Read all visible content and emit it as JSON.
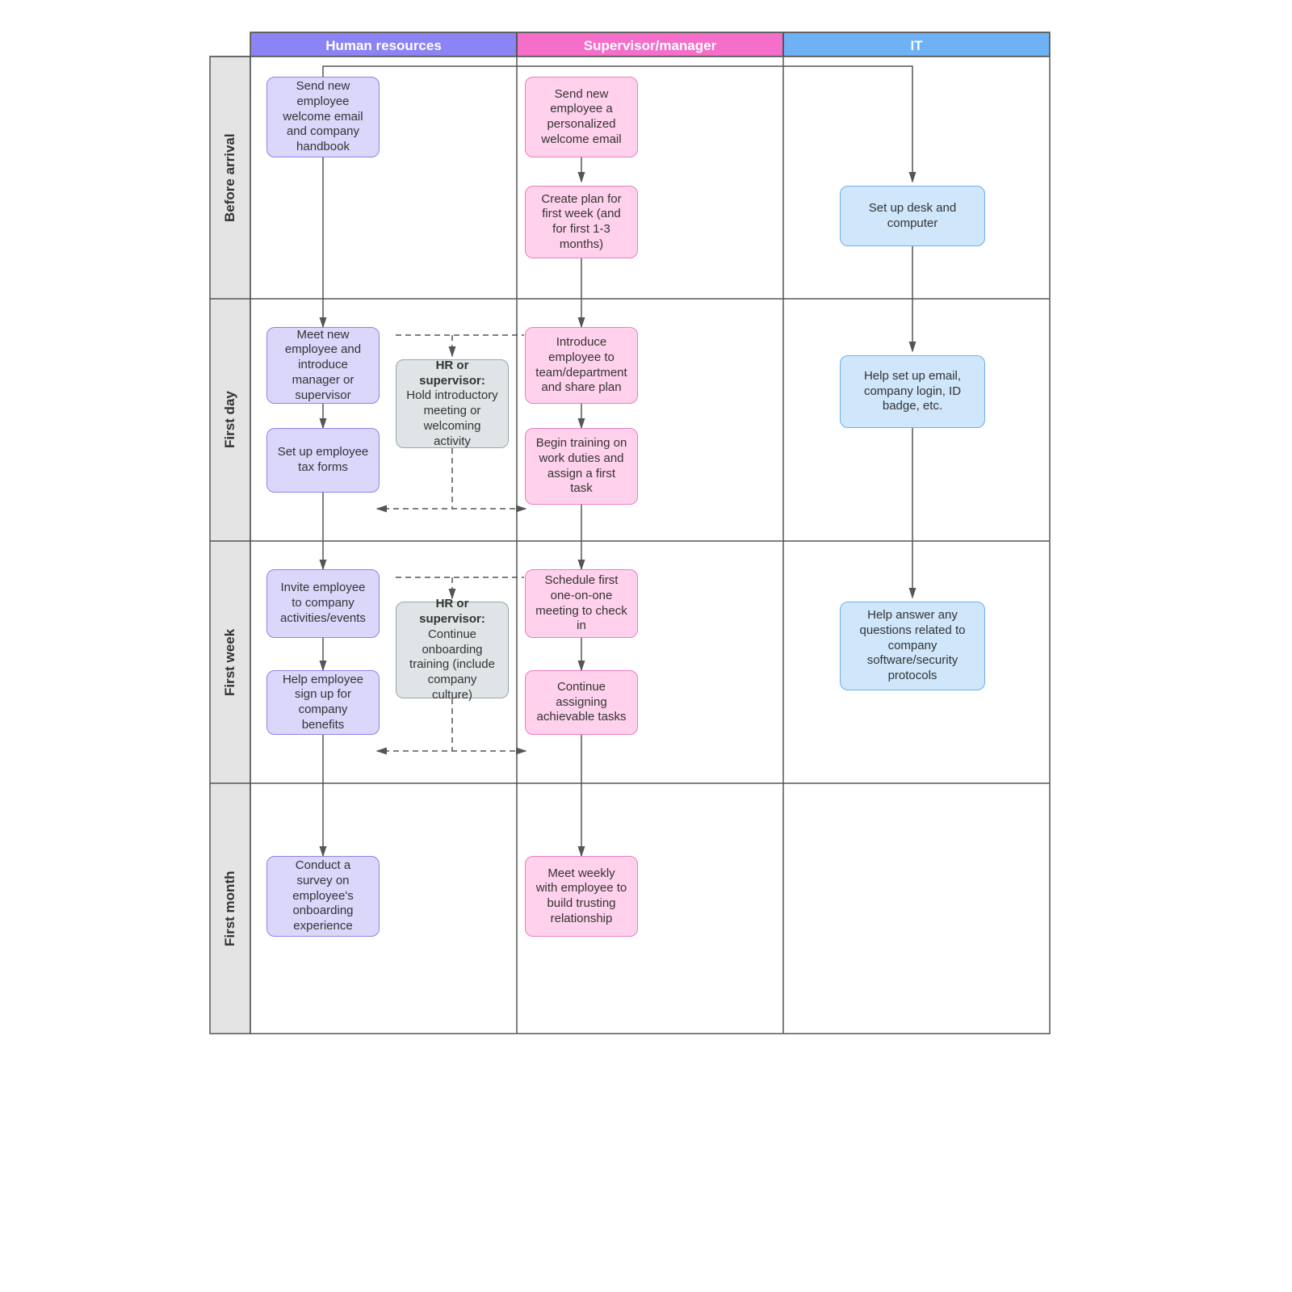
{
  "lanes": {
    "hr": "Human resources",
    "sup": "Supervisor/manager",
    "it": "IT"
  },
  "rows": {
    "before": "Before arrival",
    "firstDay": "First day",
    "firstWeek": "First week",
    "firstMonth": "First month"
  },
  "nodes": {
    "hr1": "Send new employee welcome email and company handbook",
    "sup1": "Send new employee a personalized welcome email",
    "sup2": "Create plan for first week (and for first 1-3 months)",
    "it1": "Set up desk and computer",
    "hr2": "Meet new employee and introduce manager or supervisor",
    "hr3": "Set up employee tax forms",
    "sup3": "Introduce employee to team/department and share plan",
    "sup4": "Begin training on work duties and assign a first task",
    "it2": "Help set up email, company login, ID badge, etc.",
    "shared1_title": "HR or supervisor:",
    "shared1_body": " Hold introductory meeting or welcoming activity",
    "hr4": "Invite employee to company activities/events",
    "hr5": "Help employee sign up for company benefits",
    "sup5": "Schedule first one-on-one meeting to check in",
    "sup6": "Continue assigning achievable tasks",
    "it3": "Help answer any questions related to company software/security protocols",
    "shared2_title": "HR or supervisor:",
    "shared2_body": " Continue onboarding training (include company culture)",
    "hr6": "Conduct a survey on employee's onboarding experience",
    "sup7": "Meet weekly with employee to build trusting relationship"
  },
  "colors": {
    "hrHeader": "#8c83f5",
    "supHeader": "#f56ec9",
    "itHeader": "#6eb1f5"
  }
}
